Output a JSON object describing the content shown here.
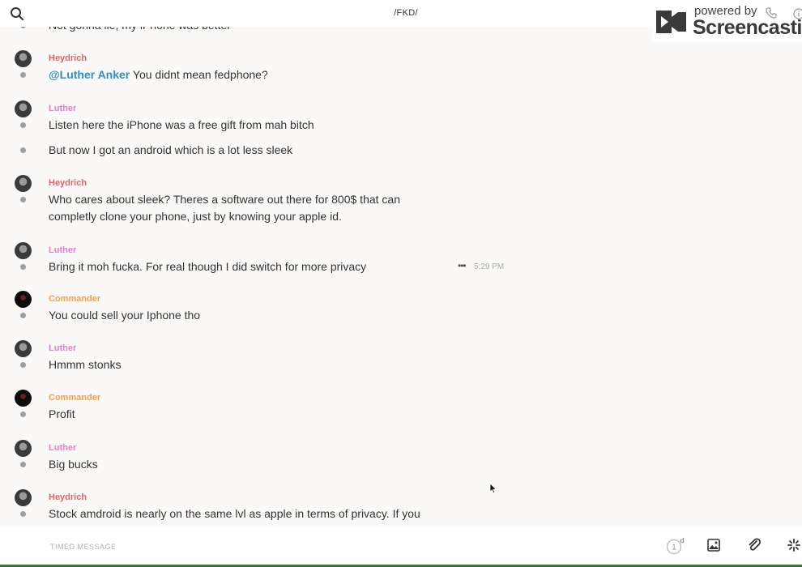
{
  "header": {
    "channel_title": "/FKD/",
    "watermark_small": "powered by",
    "watermark_big": "Screencastify"
  },
  "colors": {
    "heydrich": "#e06363",
    "luther": "#e37fc9",
    "commander": "#f0a04b",
    "mention": "#2e8fc2"
  },
  "messages": [
    {
      "text": "Not gonna lie, my iPhone was better"
    },
    {
      "author": "Heydrich",
      "mention": "@Luther Anker",
      "text": " You didnt mean fedphone?"
    },
    {
      "author": "Luther",
      "text": "Listen here the iPhone was a free gift from mah bitch"
    },
    {
      "text": "But now I got an android which is a lot less sleek"
    },
    {
      "author": "Heydrich",
      "line1": "Who cares about sleek? Theres a software out there for 800$ that can",
      "line2": "completly clone your phone, just by knowing your apple id."
    },
    {
      "author": "Luther",
      "text": "Bring it moh fucka. For real though I did switch for more privacy",
      "time": "5:29 PM"
    },
    {
      "author": "Commander",
      "text": "You could sell your Iphone tho"
    },
    {
      "author": "Luther",
      "text": "Hmmm stonks"
    },
    {
      "author": "Commander",
      "text": "Profit"
    },
    {
      "author": "Luther",
      "text": "Big bucks"
    },
    {
      "author": "Heydrich",
      "text": "Stock amdroid is nearly on the same lvl as apple in terms of privacy. If you"
    }
  ],
  "composer": {
    "placeholder": "TIMED MESSAGE",
    "timer_value": "1",
    "timer_unit": "d"
  }
}
